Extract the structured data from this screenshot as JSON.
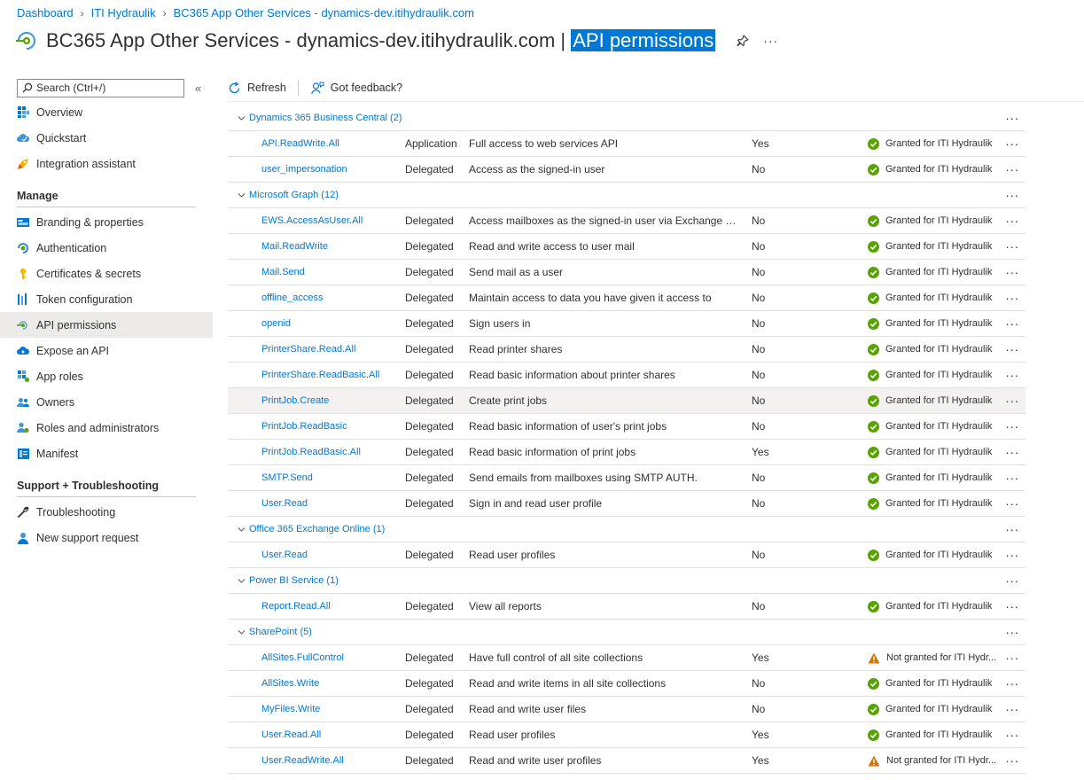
{
  "breadcrumb": [
    "Dashboard",
    "ITI Hydraulik",
    "BC365 App Other Services - dynamics-dev.itihydraulik.com"
  ],
  "header": {
    "title": "BC365 App Other Services - dynamics-dev.itihydraulik.com",
    "separator": "|",
    "page": "API permissions",
    "more": "···"
  },
  "sidebar": {
    "search_placeholder": "Search (Ctrl+/)",
    "collapse": "«",
    "top_items": [
      {
        "label": "Overview",
        "icon": "grid-icon"
      },
      {
        "label": "Quickstart",
        "icon": "cloud-icon"
      },
      {
        "label": "Integration assistant",
        "icon": "rocket-icon"
      }
    ],
    "manage_title": "Manage",
    "manage_items": [
      {
        "label": "Branding & properties",
        "icon": "branding-icon"
      },
      {
        "label": "Authentication",
        "icon": "authentication-icon"
      },
      {
        "label": "Certificates & secrets",
        "icon": "key-icon"
      },
      {
        "label": "Token configuration",
        "icon": "bars-icon"
      },
      {
        "label": "API permissions",
        "icon": "api-permissions-icon"
      },
      {
        "label": "Expose an API",
        "icon": "cloud-api-icon"
      },
      {
        "label": "App roles",
        "icon": "app-roles-icon"
      },
      {
        "label": "Owners",
        "icon": "users-icon"
      },
      {
        "label": "Roles and administrators",
        "icon": "user-roles-icon"
      },
      {
        "label": "Manifest",
        "icon": "manifest-icon"
      }
    ],
    "support_title": "Support + Troubleshooting",
    "support_items": [
      {
        "label": "Troubleshooting",
        "icon": "wrench-icon"
      },
      {
        "label": "New support request",
        "icon": "support-person-icon"
      }
    ]
  },
  "toolbar": {
    "refresh": "Refresh",
    "feedback": "Got feedback?"
  },
  "groups": [
    {
      "name": "Dynamics 365 Business Central (2)",
      "rows": [
        {
          "name": "API.ReadWrite.All",
          "type": "Application",
          "desc": "Full access to web services API",
          "admin": "Yes",
          "status": "Granted for ITI Hydraulik",
          "granted": true
        },
        {
          "name": "user_impersonation",
          "type": "Delegated",
          "desc": "Access as the signed-in user",
          "admin": "No",
          "status": "Granted for ITI Hydraulik",
          "granted": true
        }
      ]
    },
    {
      "name": "Microsoft Graph (12)",
      "rows": [
        {
          "name": "EWS.AccessAsUser.All",
          "type": "Delegated",
          "desc": "Access mailboxes as the signed-in user via Exchange Web ...",
          "admin": "No",
          "status": "Granted for ITI Hydraulik",
          "granted": true
        },
        {
          "name": "Mail.ReadWrite",
          "type": "Delegated",
          "desc": "Read and write access to user mail",
          "admin": "No",
          "status": "Granted for ITI Hydraulik",
          "granted": true
        },
        {
          "name": "Mail.Send",
          "type": "Delegated",
          "desc": "Send mail as a user",
          "admin": "No",
          "status": "Granted for ITI Hydraulik",
          "granted": true
        },
        {
          "name": "offline_access",
          "type": "Delegated",
          "desc": "Maintain access to data you have given it access to",
          "admin": "No",
          "status": "Granted for ITI Hydraulik",
          "granted": true
        },
        {
          "name": "openid",
          "type": "Delegated",
          "desc": "Sign users in",
          "admin": "No",
          "status": "Granted for ITI Hydraulik",
          "granted": true
        },
        {
          "name": "PrinterShare.Read.All",
          "type": "Delegated",
          "desc": "Read printer shares",
          "admin": "No",
          "status": "Granted for ITI Hydraulik",
          "granted": true
        },
        {
          "name": "PrinterShare.ReadBasic.All",
          "type": "Delegated",
          "desc": "Read basic information about printer shares",
          "admin": "No",
          "status": "Granted for ITI Hydraulik",
          "granted": true
        },
        {
          "name": "PrintJob.Create",
          "type": "Delegated",
          "desc": "Create print jobs",
          "admin": "No",
          "status": "Granted for ITI Hydraulik",
          "granted": true,
          "selected": true
        },
        {
          "name": "PrintJob.ReadBasic",
          "type": "Delegated",
          "desc": "Read basic information of user's print jobs",
          "admin": "No",
          "status": "Granted for ITI Hydraulik",
          "granted": true
        },
        {
          "name": "PrintJob.ReadBasic.All",
          "type": "Delegated",
          "desc": "Read basic information of print jobs",
          "admin": "Yes",
          "status": "Granted for ITI Hydraulik",
          "granted": true
        },
        {
          "name": "SMTP.Send",
          "type": "Delegated",
          "desc": "Send emails from mailboxes using SMTP AUTH.",
          "admin": "No",
          "status": "Granted for ITI Hydraulik",
          "granted": true
        },
        {
          "name": "User.Read",
          "type": "Delegated",
          "desc": "Sign in and read user profile",
          "admin": "No",
          "status": "Granted for ITI Hydraulik",
          "granted": true
        }
      ]
    },
    {
      "name": "Office 365 Exchange Online (1)",
      "rows": [
        {
          "name": "User.Read",
          "type": "Delegated",
          "desc": "Read user profiles",
          "admin": "No",
          "status": "Granted for ITI Hydraulik",
          "granted": true
        }
      ]
    },
    {
      "name": "Power BI Service (1)",
      "rows": [
        {
          "name": "Report.Read.All",
          "type": "Delegated",
          "desc": "View all reports",
          "admin": "No",
          "status": "Granted for ITI Hydraulik",
          "granted": true
        }
      ]
    },
    {
      "name": "SharePoint (5)",
      "rows": [
        {
          "name": "AllSites.FullControl",
          "type": "Delegated",
          "desc": "Have full control of all site collections",
          "admin": "Yes",
          "status": "Not granted for ITI Hydr...",
          "granted": false
        },
        {
          "name": "AllSites.Write",
          "type": "Delegated",
          "desc": "Read and write items in all site collections",
          "admin": "No",
          "status": "Granted for ITI Hydraulik",
          "granted": true
        },
        {
          "name": "MyFiles.Write",
          "type": "Delegated",
          "desc": "Read and write user files",
          "admin": "No",
          "status": "Granted for ITI Hydraulik",
          "granted": true
        },
        {
          "name": "User.Read.All",
          "type": "Delegated",
          "desc": "Read user profiles",
          "admin": "Yes",
          "status": "Granted for ITI Hydraulik",
          "granted": true
        },
        {
          "name": "User.ReadWrite.All",
          "type": "Delegated",
          "desc": "Read and write user profiles",
          "admin": "Yes",
          "status": "Not granted for ITI Hydr...",
          "granted": false
        }
      ]
    }
  ],
  "row_more": "···",
  "colors": {
    "accent": "#0078d4",
    "granted": "#57a300",
    "warning": "#d47500",
    "selection": "#0078d4"
  }
}
